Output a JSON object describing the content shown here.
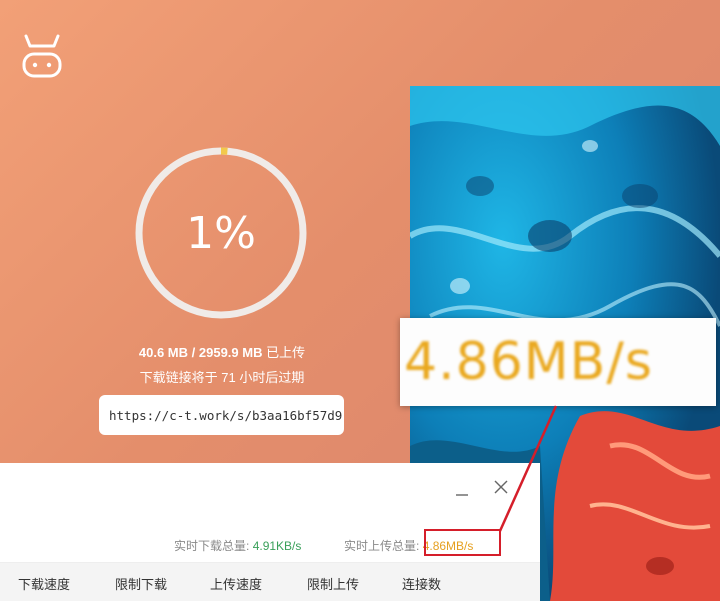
{
  "progress": {
    "percent_label": "1%",
    "fraction": 0.01,
    "uploaded": "40.6 MB",
    "separator": " / ",
    "total": "2959.9 MB",
    "status": "已上传"
  },
  "expire_text": "下载链接将于 71 小时后过期",
  "share_link": "https://c-t.work/s/b3aa16bf57d9",
  "zoom_callout": "4.86MB/s",
  "speeds": {
    "download_label": "实时下载总量:",
    "download_value": "4.91KB/s",
    "upload_label": "实时上传总量:",
    "upload_value": "4.86MB/s"
  },
  "window_controls": {
    "minimize": "—",
    "close": "✕"
  },
  "tabs": [
    "下载速度",
    "限制下载",
    "上传速度",
    "限制上传",
    "连接数"
  ],
  "colors": {
    "accent_orange": "#e6a020",
    "download_green": "#3aa05a",
    "highlight_red": "#d51e2a",
    "ring_track": "#f0ebe8",
    "ring_progress": "#f2c94c"
  },
  "icons": [
    "cow-logo-icon",
    "minimize-icon",
    "close-icon"
  ]
}
